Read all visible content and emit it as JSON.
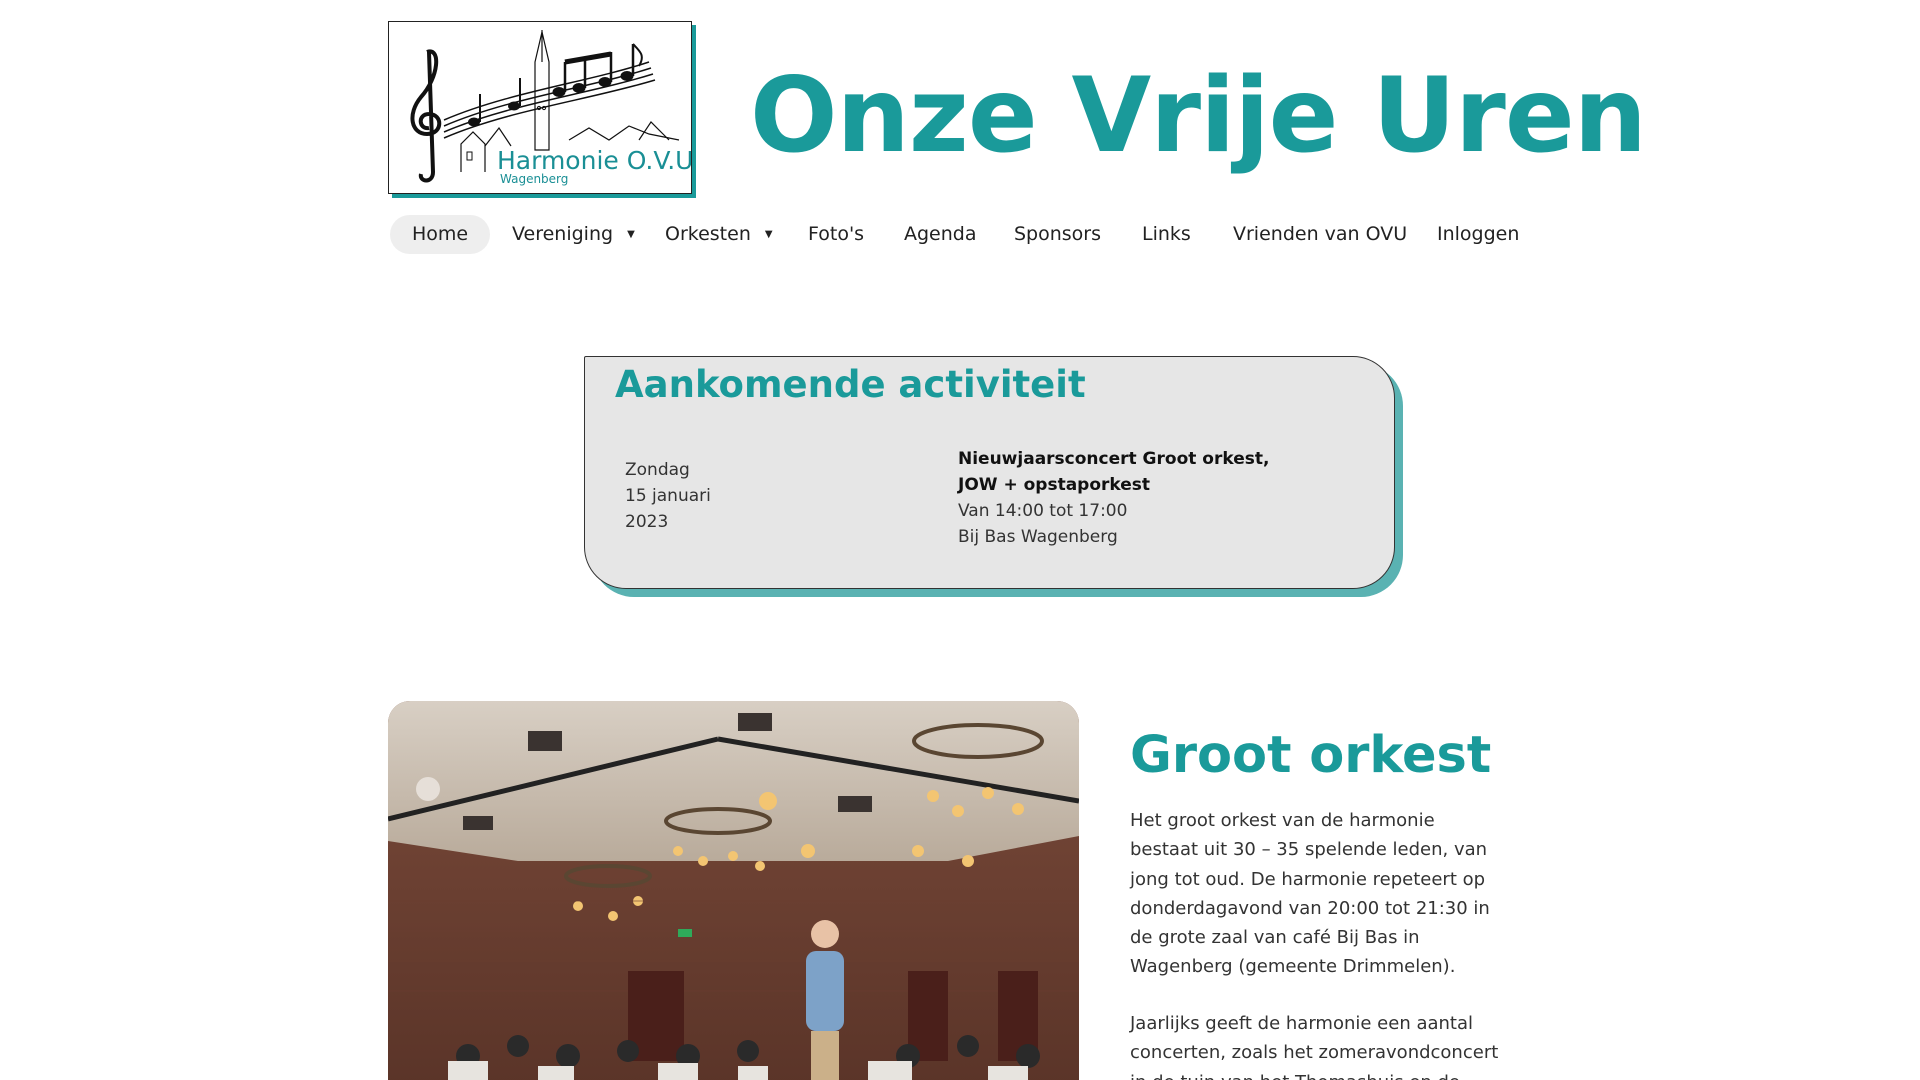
{
  "header": {
    "logo": {
      "name": "Harmonie O.V.U",
      "place": "Wagenberg",
      "icon": "music-notes-church-logo"
    },
    "site_title": "Onze Vrije Uren"
  },
  "nav": {
    "items": [
      {
        "label": "Home",
        "active": true,
        "dropdown": false
      },
      {
        "label": "Vereniging",
        "active": false,
        "dropdown": true
      },
      {
        "label": "Orkesten",
        "active": false,
        "dropdown": true
      },
      {
        "label": "Foto's",
        "active": false,
        "dropdown": false
      },
      {
        "label": "Agenda",
        "active": false,
        "dropdown": false
      },
      {
        "label": "Sponsors",
        "active": false,
        "dropdown": false
      },
      {
        "label": "Links",
        "active": false,
        "dropdown": false
      },
      {
        "label": "Vrienden van OVU",
        "active": false,
        "dropdown": false
      },
      {
        "label": "Inloggen",
        "active": false,
        "dropdown": false
      }
    ],
    "dropdown_icon": "caret-down-icon"
  },
  "activity": {
    "heading": "Aankomende activiteit",
    "date": {
      "day": "Zondag",
      "date": "15 januari",
      "year": "2023"
    },
    "title": "Nieuwjaarsconcert Groot orkest, JOW + opstaporkest",
    "time": "Van 14:00 tot 17:00",
    "location": "Bij Bas Wagenberg"
  },
  "section": {
    "heading": "Groot orkest",
    "paragraph1": "Het groot orkest van de harmonie bestaat uit 30 – 35 spelende leden, van jong tot oud. De harmonie repeteert op donderdagavond van 20:00 tot 21:30 in de grote zaal van café Bij Bas in Wagenberg (gemeente Drimmelen).",
    "paragraph2": "Jaarlijks geeft de harmonie een aantal concerten, zoals het zomeravondconcert in de tuin van het Thomashuis en de"
  },
  "colors": {
    "accent": "#1a9a9a",
    "card_shadow": "#5ab2b2",
    "card_bg": "#e6e6e6",
    "nav_active_bg": "#eeeeee"
  }
}
